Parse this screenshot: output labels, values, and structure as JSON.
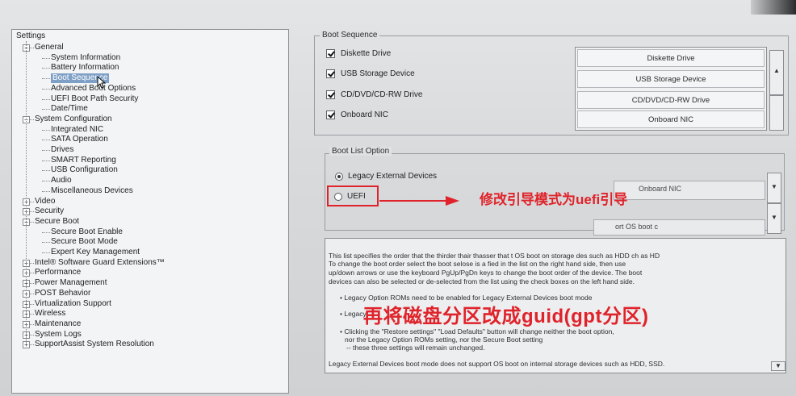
{
  "tree": {
    "root": "Settings",
    "items": [
      {
        "label": "General",
        "level": 1
      },
      {
        "label": "System Information",
        "level": 2
      },
      {
        "label": "Battery Information",
        "level": 2
      },
      {
        "label": "Boot Sequence",
        "level": 2,
        "selected": true
      },
      {
        "label": "Advanced Boot Options",
        "level": 2
      },
      {
        "label": "UEFI Boot Path Security",
        "level": 2
      },
      {
        "label": "Date/Time",
        "level": 2
      },
      {
        "label": "System Configuration",
        "level": 1
      },
      {
        "label": "Integrated NIC",
        "level": 2
      },
      {
        "label": "SATA Operation",
        "level": 2
      },
      {
        "label": "Drives",
        "level": 2
      },
      {
        "label": "SMART Reporting",
        "level": 2
      },
      {
        "label": "USB Configuration",
        "level": 2
      },
      {
        "label": "Audio",
        "level": 2
      },
      {
        "label": "Miscellaneous Devices",
        "level": 2
      },
      {
        "label": "Video",
        "level": 1
      },
      {
        "label": "Security",
        "level": 1
      },
      {
        "label": "Secure Boot",
        "level": 1
      },
      {
        "label": "Secure Boot Enable",
        "level": 2
      },
      {
        "label": "Secure Boot Mode",
        "level": 2
      },
      {
        "label": "Expert Key Management",
        "level": 2
      },
      {
        "label": "Intel® Software Guard Extensions™",
        "level": 1
      },
      {
        "label": "Performance",
        "level": 1
      },
      {
        "label": "Power Management",
        "level": 1
      },
      {
        "label": "POST Behavior",
        "level": 1
      },
      {
        "label": "Virtualization Support",
        "level": 1
      },
      {
        "label": "Wireless",
        "level": 1
      },
      {
        "label": "Maintenance",
        "level": 1
      },
      {
        "label": "System Logs",
        "level": 1
      },
      {
        "label": "SupportAssist System Resolution",
        "level": 1
      }
    ]
  },
  "boot_sequence": {
    "title": "Boot Sequence",
    "checks": [
      "Diskette Drive",
      "USB Storage Device",
      "CD/DVD/CD-RW Drive",
      "Onboard NIC"
    ],
    "order": [
      "Diskette Drive",
      "USB Storage Device",
      "CD/DVD/CD-RW Drive",
      "Onboard NIC"
    ]
  },
  "boot_list": {
    "title": "Boot List Option",
    "options": [
      "Legacy External Devices",
      "UEFI"
    ],
    "selected": "Legacy External Devices",
    "blurred_field_1": "Onboard NIC",
    "blurred_field_2": "ort OS boot c"
  },
  "help": {
    "lines": [
      "This list specifies the order that the thirder thair thasser that t    OS boot on storage des such as HDD ch as HD",
      "To change the boot order select the boot selose is a fied in the list on the right hand side, then use",
      "up/down arrows or use the keyboard PgUp/PgDn keys to change the boot order of the device. The boot",
      "devices can also be selected or de-selected from the list using the check boxes on the left hand side.",
      "• Legacy Option ROMs need to be enabled for Legacy External Devices boot mode",
      "• Legacy",
      "• Clicking the \"Restore settings\" \"Load Defaults\" button will change neither the boot option,",
      "nor the Legacy Option ROMs setting, nor the Secure Boot setting",
      "-- these three settings will remain unchanged.",
      "Legacy External Devices boot mode does not support OS boot on internal storage devices such as HDD, SSD."
    ]
  },
  "annotations": {
    "arrow_note": "修改引导模式为uefi引导",
    "bottom_note": "再将磁盘分区改成guid(gpt分区)"
  },
  "colors": {
    "annotation_red": "#e0232a",
    "selection_blue": "#7fa0c6"
  }
}
